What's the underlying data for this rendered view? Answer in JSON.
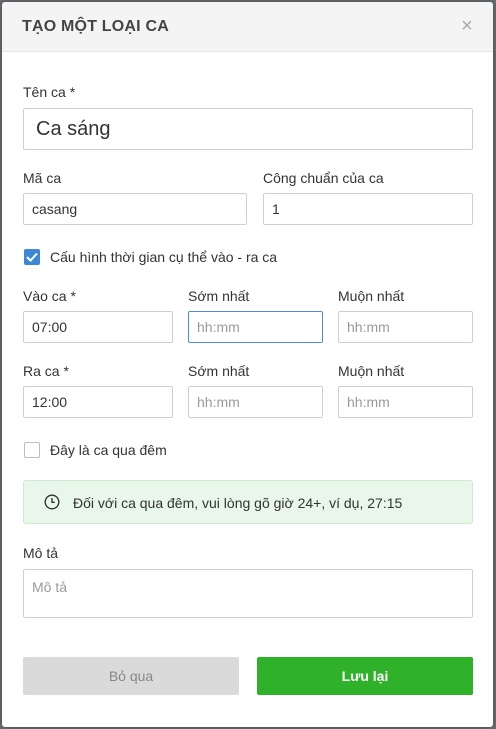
{
  "dialog": {
    "title": "TẠO MỘT LOẠI CA",
    "close_glyph": "×"
  },
  "form": {
    "shift_name": {
      "label": "Tên ca *",
      "value": "Ca sáng"
    },
    "shift_code": {
      "label": "Mã ca",
      "value": "casang"
    },
    "standard_work": {
      "label": "Công chuẩn của ca",
      "value": "1"
    },
    "configure_time": {
      "label": "Cấu hình thời gian cụ thể vào - ra ca",
      "checked": true
    },
    "check_in": {
      "label": "Vào ca *",
      "value": "07:00",
      "earliest_label": "Sớm nhất",
      "earliest_placeholder": "hh:mm",
      "latest_label": "Muộn nhất",
      "latest_placeholder": "hh:mm"
    },
    "check_out": {
      "label": "Ra ca *",
      "value": "12:00",
      "earliest_label": "Sớm nhất",
      "earliest_placeholder": "hh:mm",
      "latest_label": "Muộn nhất",
      "latest_placeholder": "hh:mm"
    },
    "overnight": {
      "label": "Đây là ca qua đêm",
      "checked": false
    },
    "notice": {
      "icon": "clock-icon",
      "text": "Đối với ca qua đêm, vui lòng gõ giờ 24+, ví dụ, 27:15"
    },
    "description": {
      "label": "Mô tả",
      "placeholder": "Mô tả",
      "value": ""
    }
  },
  "actions": {
    "cancel_label": "Bỏ qua",
    "save_label": "Lưu lại"
  },
  "colors": {
    "primary_check": "#3d86d6",
    "save_button": "#2fb12a",
    "notice_bg": "#e8f7ea",
    "focus_border": "#4a90d9"
  }
}
